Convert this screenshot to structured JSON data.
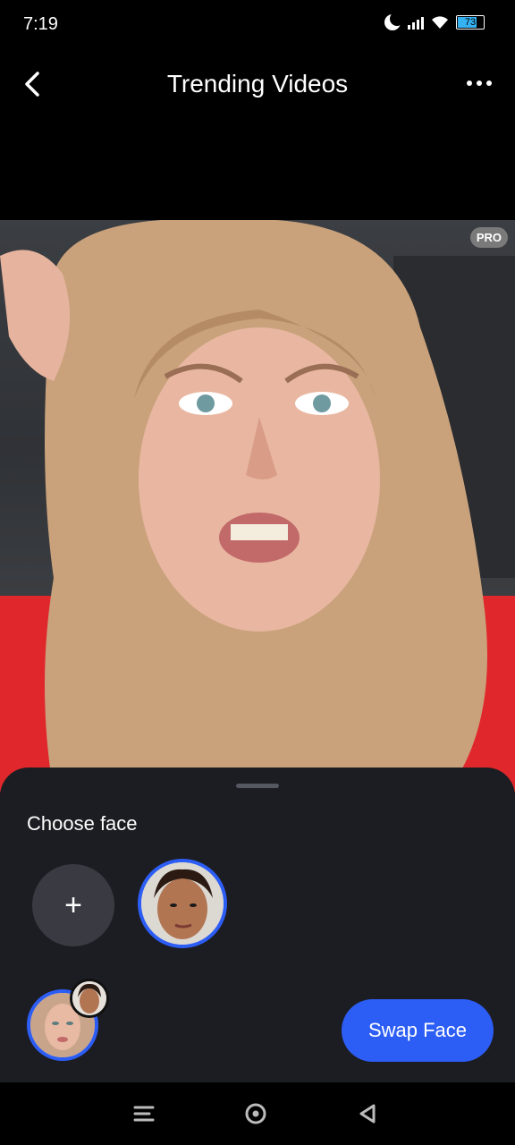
{
  "status_bar": {
    "time": "7:19",
    "battery": "73"
  },
  "header": {
    "title": "Trending Videos"
  },
  "video": {
    "badge": "PRO"
  },
  "sheet": {
    "section_title": "Choose face",
    "add_label": "+",
    "swap_button": "Swap Face"
  },
  "colors": {
    "accent": "#2c5df5",
    "sheet_bg": "#1c1d22"
  }
}
